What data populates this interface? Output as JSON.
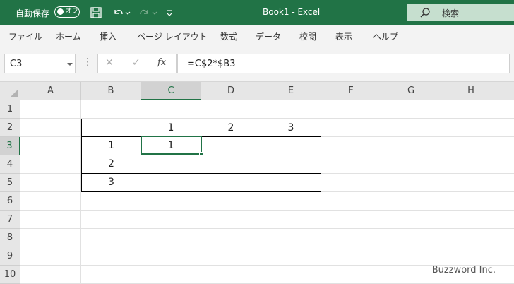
{
  "titlebar": {
    "autosave_label": "自動保存",
    "autosave_state": "オフ",
    "document_title": "Book1  -  Excel",
    "search_label": "検索",
    "icons": [
      "save-icon",
      "undo-icon",
      "redo-icon",
      "customize-quick-access-icon",
      "search-icon"
    ],
    "colors": {
      "bar": "#217346",
      "search_bg": "#c6dfcf"
    }
  },
  "ribbon": {
    "tabs": [
      "ファイル",
      "ホーム",
      "挿入",
      "ページ レイアウト",
      "数式",
      "データ",
      "校閲",
      "表示",
      "ヘルプ"
    ]
  },
  "formula_bar": {
    "name_box": "C3",
    "fx_label": "fx",
    "formula": "=C$2*$B3",
    "icons": [
      "cancel-icon",
      "enter-icon",
      "insert-function-icon"
    ]
  },
  "grid": {
    "columns": [
      "A",
      "B",
      "C",
      "D",
      "E",
      "F",
      "G",
      "H"
    ],
    "rows": [
      "1",
      "2",
      "3",
      "4",
      "5",
      "6",
      "7",
      "8",
      "9",
      "10"
    ],
    "active_cell": "C3",
    "cells": {
      "C2": "1",
      "D2": "2",
      "E2": "3",
      "B3": "1",
      "C3": "1",
      "B4": "2",
      "B5": "3"
    },
    "accent": "#217346"
  },
  "watermark": "Buzzword Inc."
}
